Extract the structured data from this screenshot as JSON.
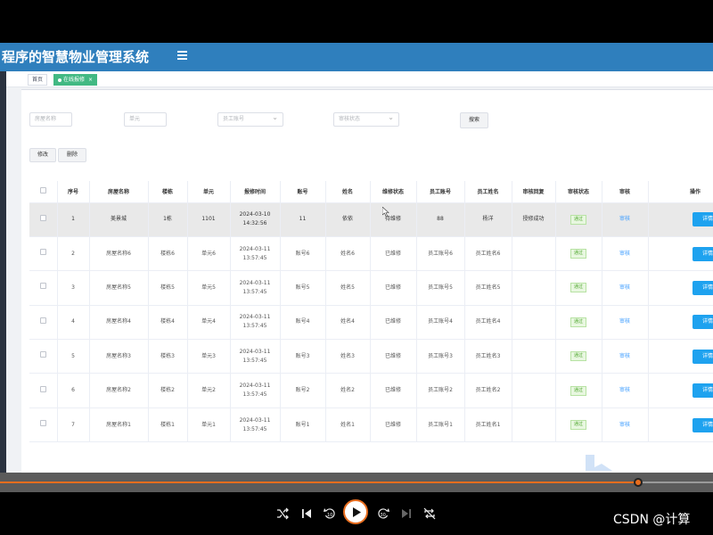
{
  "app": {
    "title": "程序的智慧物业管理系统",
    "header_color": "#2f7fbd"
  },
  "tabs": [
    {
      "label": "首页"
    },
    {
      "label": "在线报修",
      "close": "×"
    }
  ],
  "filters": {
    "house_name_placeholder": "房屋名称",
    "unit_placeholder": "单元",
    "staff_account_placeholder": "员工账号",
    "review_status_placeholder": "审核状态",
    "search_label": "搜索"
  },
  "actions": {
    "edit_label": "修改",
    "delete_label": "删除"
  },
  "table": {
    "columns": [
      "序号",
      "房屋名称",
      "楼栋",
      "单元",
      "报修时间",
      "账号",
      "姓名",
      "维修状态",
      "员工账号",
      "员工姓名",
      "审核回复",
      "审核状态",
      "审核",
      "操作"
    ],
    "rows": [
      {
        "no": "1",
        "house": "美景城",
        "building": "1栋",
        "unit": "1101",
        "date": "2024-03-10",
        "time": "14:32:56",
        "account": "11",
        "name": "依依",
        "repair_status": "待维修",
        "staff_account": "88",
        "staff_name": "杨洋",
        "reply": "授修成功",
        "review_status": "通过",
        "audit": "审核",
        "op": "详情"
      },
      {
        "no": "2",
        "house": "房屋名称6",
        "building": "楼栋6",
        "unit": "单元6",
        "date": "2024-03-11",
        "time": "13:57:45",
        "account": "账号6",
        "name": "姓名6",
        "repair_status": "已维修",
        "staff_account": "员工账号6",
        "staff_name": "员工姓名6",
        "reply": "",
        "review_status": "通过",
        "audit": "审核",
        "op": "详情"
      },
      {
        "no": "3",
        "house": "房屋名称5",
        "building": "楼栋5",
        "unit": "单元5",
        "date": "2024-03-11",
        "time": "13:57:45",
        "account": "账号5",
        "name": "姓名5",
        "repair_status": "已维修",
        "staff_account": "员工账号5",
        "staff_name": "员工姓名5",
        "reply": "",
        "review_status": "通过",
        "audit": "审核",
        "op": "详情"
      },
      {
        "no": "4",
        "house": "房屋名称4",
        "building": "楼栋4",
        "unit": "单元4",
        "date": "2024-03-11",
        "time": "13:57:45",
        "account": "账号4",
        "name": "姓名4",
        "repair_status": "已维修",
        "staff_account": "员工账号4",
        "staff_name": "员工姓名4",
        "reply": "",
        "review_status": "通过",
        "audit": "审核",
        "op": "详情"
      },
      {
        "no": "5",
        "house": "房屋名称3",
        "building": "楼栋3",
        "unit": "单元3",
        "date": "2024-03-11",
        "time": "13:57:45",
        "account": "账号3",
        "name": "姓名3",
        "repair_status": "已维修",
        "staff_account": "员工账号3",
        "staff_name": "员工姓名3",
        "reply": "",
        "review_status": "通过",
        "audit": "审核",
        "op": "详情"
      },
      {
        "no": "6",
        "house": "房屋名称2",
        "building": "楼栋2",
        "unit": "单元2",
        "date": "2024-03-11",
        "time": "13:57:45",
        "account": "账号2",
        "name": "姓名2",
        "repair_status": "已维修",
        "staff_account": "员工账号2",
        "staff_name": "员工姓名2",
        "reply": "",
        "review_status": "通过",
        "audit": "审核",
        "op": "详情"
      },
      {
        "no": "7",
        "house": "房屋名称1",
        "building": "楼栋1",
        "unit": "单元1",
        "date": "2024-03-11",
        "time": "13:57:45",
        "account": "账号1",
        "name": "姓名1",
        "repair_status": "已维修",
        "staff_account": "员工账号1",
        "staff_name": "员工姓名1",
        "reply": "",
        "review_status": "通过",
        "audit": "审核",
        "op": "详情"
      }
    ]
  },
  "player": {
    "progress": 0.895,
    "accent_color": "#e86d1e",
    "credit": "CSDN @计算"
  }
}
